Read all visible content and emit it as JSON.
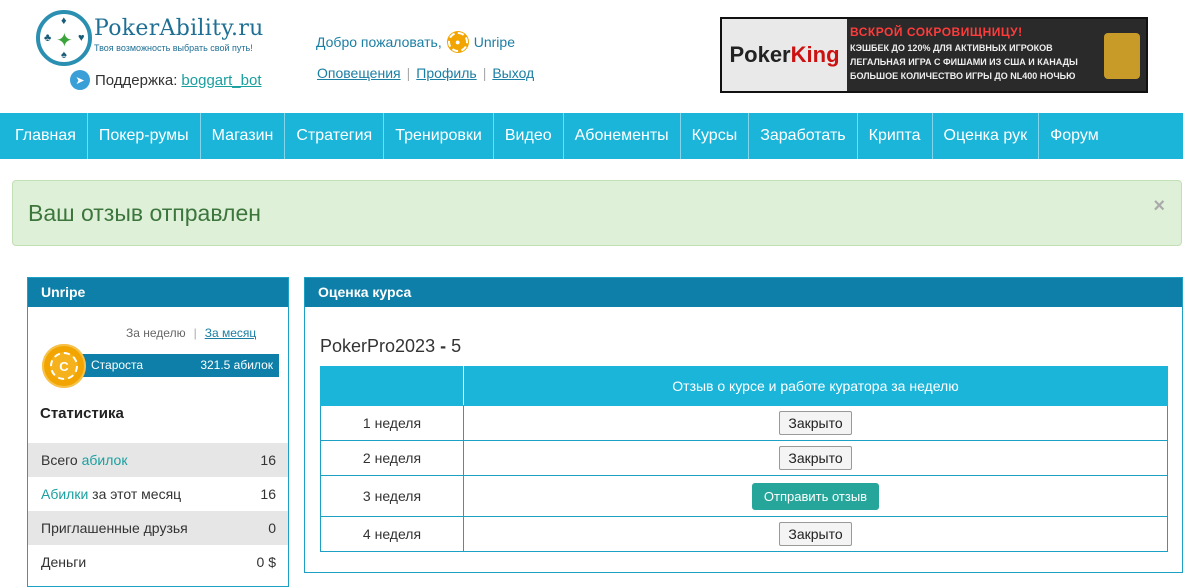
{
  "header": {
    "logo_title": "PokerAbility.ru",
    "logo_subtitle": "Твоя возможность выбрать свой путь!",
    "support_label": "Поддержка:",
    "support_link": "boggart_bot",
    "welcome": "Добро пожаловать,",
    "username": "Unripe",
    "links": [
      "Оповещения",
      "Профиль",
      "Выход"
    ],
    "banner": {
      "brand_a": "Poker",
      "brand_b": "King",
      "headline": "ВСКРОЙ СОКРОВИЩНИЦУ!",
      "lines": [
        "КЭШБЕК ДО 120% ДЛЯ АКТИВНЫХ ИГРОКОВ",
        "ЛЕГАЛЬНАЯ ИГРА С ФИШАМИ ИЗ США И КАНАДЫ",
        "БОЛЬШОЕ КОЛИЧЕСТВО ИГРЫ ДО NL400 НОЧЬЮ"
      ]
    }
  },
  "nav": [
    "Главная",
    "Покер-румы",
    "Магазин",
    "Стратегия",
    "Тренировки",
    "Видео",
    "Абонементы",
    "Курсы",
    "Заработать",
    "Крипта",
    "Оценка рук",
    "Форум"
  ],
  "alert": {
    "text": "Ваш отзыв отправлен",
    "close": "×"
  },
  "sidebar": {
    "title": "Unripe",
    "period_week": "За неделю",
    "period_month": "За месяц",
    "chip_letter": "C",
    "rank_name": "Староста",
    "rank_value": "321.5 абилок",
    "stats_title": "Статистика",
    "stats": [
      {
        "pre": "Всего ",
        "hl": "абилок",
        "post": "",
        "value": "16"
      },
      {
        "pre": "",
        "hl": "Абилки",
        "post": " за этот месяц",
        "value": "16"
      },
      {
        "pre": "Приглашенные друзья",
        "hl": "",
        "post": "",
        "value": "0"
      },
      {
        "pre": "Деньги",
        "hl": "",
        "post": "",
        "value": "0 $"
      }
    ]
  },
  "main": {
    "panel_title": "Оценка курса",
    "course_name": "PokerPro2023",
    "course_sep": " - ",
    "course_num": "5",
    "table_header": "Отзыв о курсе и работе куратора за неделю",
    "rows": [
      {
        "week": "1 неделя",
        "action": "Закрыто",
        "type": "closed"
      },
      {
        "week": "2 неделя",
        "action": "Закрыто",
        "type": "closed"
      },
      {
        "week": "3 неделя",
        "action": "Отправить отзыв",
        "type": "send"
      },
      {
        "week": "4 неделя",
        "action": "Закрыто",
        "type": "closed"
      }
    ]
  }
}
